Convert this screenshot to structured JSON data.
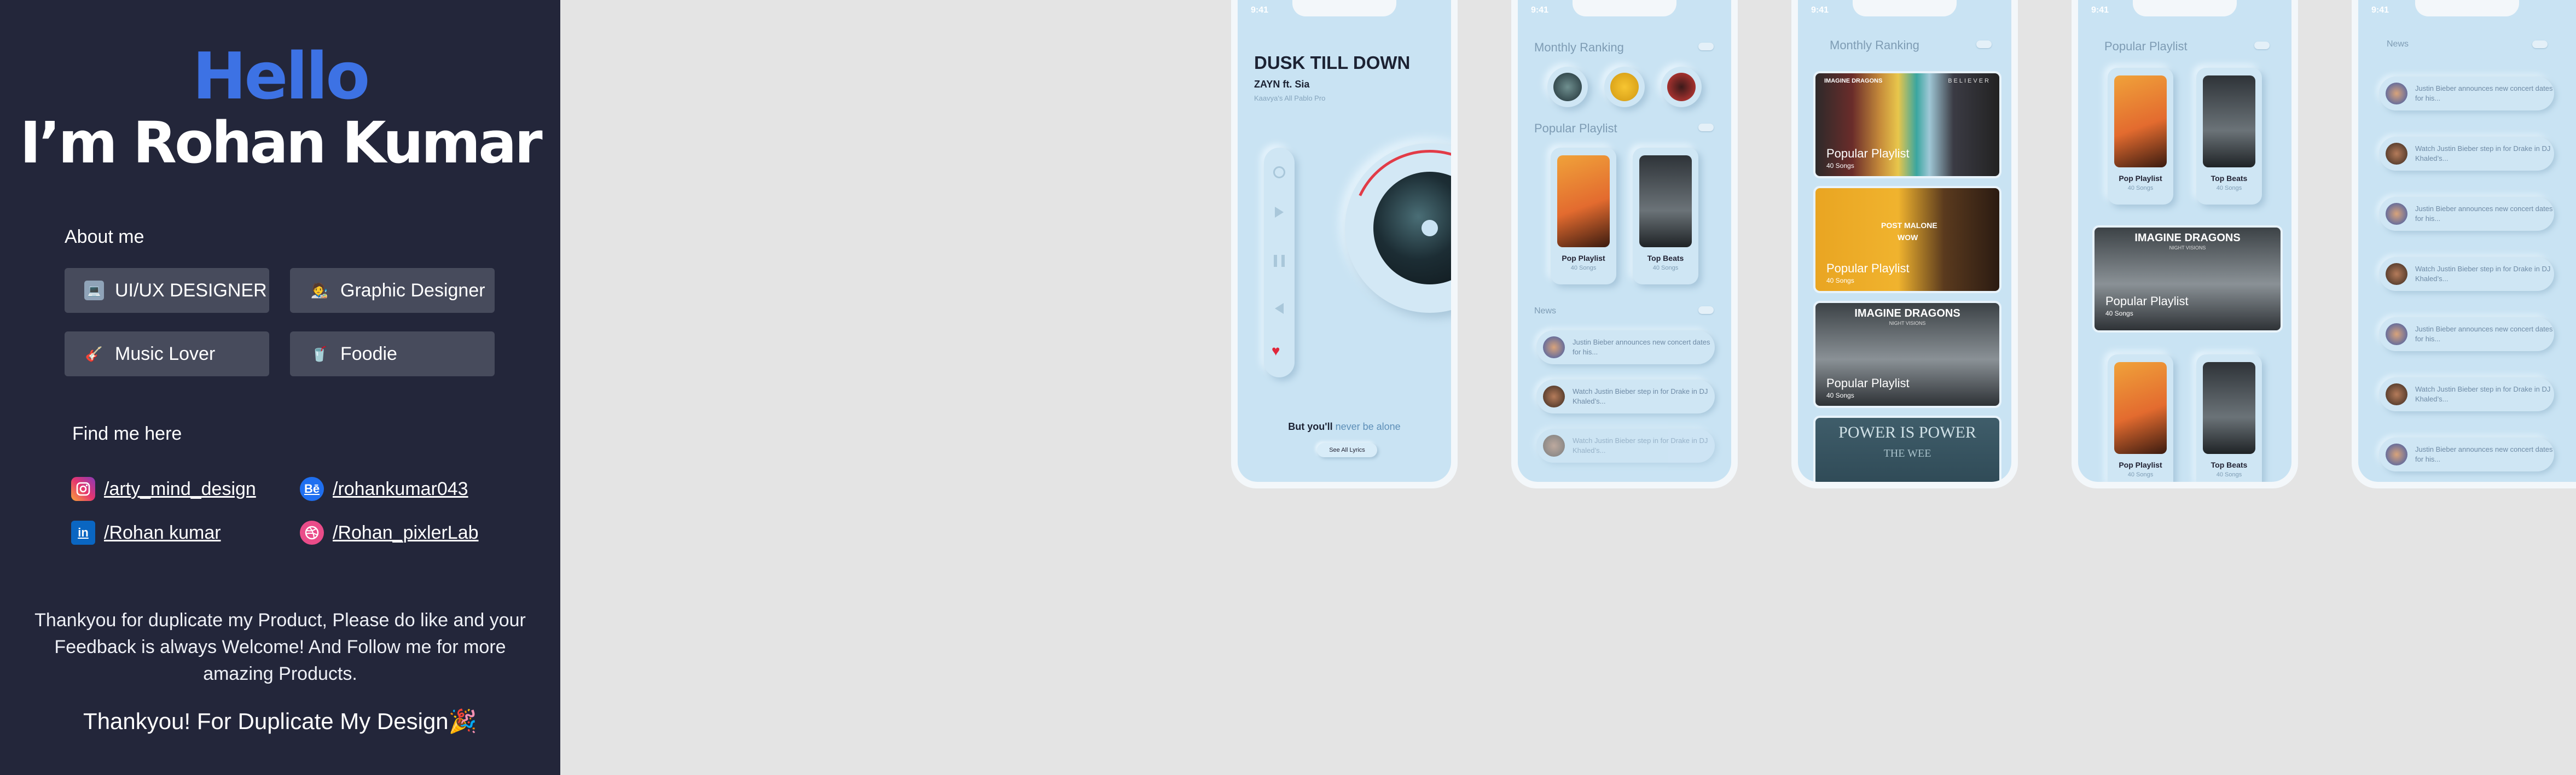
{
  "profile": {
    "hello": "Hello",
    "name": "I’m Rohan Kumar",
    "about_heading": "About me",
    "chips": [
      {
        "label": "UI/UX DESIGNER",
        "icon": "laptop-icon"
      },
      {
        "label": "Graphic Designer",
        "icon": "designer-icon"
      },
      {
        "label": "Music Lover",
        "icon": "guitar-icon"
      },
      {
        "label": "Foodie",
        "icon": "drink-icon"
      }
    ],
    "find_heading": "Find me here",
    "links": [
      {
        "label": "/arty_mind_design",
        "icon": "instagram-icon"
      },
      {
        "label": "/rohankumar043",
        "icon": "behance-icon",
        "icon_text": "Bē"
      },
      {
        "label": "/Rohan kumar",
        "icon": "linkedin-icon",
        "icon_text": "in"
      },
      {
        "label": "/Rohan_pixlerLab",
        "icon": "dribbble-icon"
      }
    ],
    "thanks_text": "Thankyou for duplicate my Product, Please do like and your Feedback is always Welcome! And Follow me for more amazing Products.",
    "thanks_footer": "Thankyou! For Duplicate My Design🎉"
  },
  "colors": {
    "panel_bg": "#23263a",
    "accent_blue": "#3d72e4",
    "chip_bg": "#474b5c",
    "canvas_bg": "#e4e4e4",
    "screen_bg": "#c9e3f3"
  },
  "phone1": {
    "time": "9:41",
    "song_title": "DUSK TILL DOWN",
    "artist": "ZAYN  ft. Sia",
    "album": "Kaavya's All Pablo Pro",
    "lyric_prefix": "But you'll",
    "lyric_highlight": "never be alone",
    "lyrics_button": "See All Lyrics"
  },
  "phone2": {
    "time": "9:41",
    "ranking_heading": "Monthly Ranking",
    "playlist_heading": "Popular Playlist",
    "playlists": [
      {
        "title": "Pop Playlist",
        "sub": "40 Songs"
      },
      {
        "title": "Top Beats",
        "sub": "40 Songs"
      }
    ],
    "news_heading": "News",
    "news": [
      "Justin Bieber announces new concert dates for his...",
      "Watch Justin Bieber step in for Drake in DJ Khaled’s...",
      "Watch Justin Bieber step in for Drake in DJ Khaled’s..."
    ]
  },
  "phone3": {
    "time": "9:41",
    "ranking_heading": "Monthly Ranking",
    "banners": [
      {
        "title": "Popular Playlist",
        "sub": "40 Songs",
        "art": "IMAGINE DRAGONS",
        "art2": "BELIEVER"
      },
      {
        "title": "Popular Playlist",
        "sub": "40 Songs",
        "art": "POST MALONE",
        "art2": "WOW"
      },
      {
        "title": "Popular Playlist",
        "sub": "40 Songs",
        "art": "IMAGINE DRAGONS",
        "art2": "NIGHT VISIONS"
      },
      {
        "title": "",
        "sub": "",
        "art": "POWER IS POWER",
        "art2": "THE WEE"
      }
    ]
  },
  "phone4": {
    "time": "9:41",
    "playlist_heading": "Popular Playlist",
    "playlists": [
      {
        "title": "Pop Playlist",
        "sub": "40 Songs"
      },
      {
        "title": "Top Beats",
        "sub": "40 Songs"
      }
    ],
    "feature": {
      "title": "Popular Playlist",
      "sub": "40 Songs",
      "art": "IMAGINE DRAGONS",
      "art2": "NIGHT VISIONS"
    },
    "playlists2": [
      {
        "title": "Pop Playlist",
        "sub": "40 Songs"
      },
      {
        "title": "Top Beats",
        "sub": "40 Songs"
      }
    ]
  },
  "phone5": {
    "time": "9:41",
    "news_heading": "News",
    "news": [
      "Justin Bieber announces new concert dates for his...",
      "Watch Justin Bieber step in for Drake in DJ Khaled’s...",
      "Justin Bieber announces new concert dates for his...",
      "Watch Justin Bieber step in for Drake in DJ Khaled’s...",
      "Justin Bieber announces new concert dates for his...",
      "Watch Justin Bieber step in for Drake in DJ Khaled’s...",
      "Justin Bieber announces new concert dates for his..."
    ]
  }
}
